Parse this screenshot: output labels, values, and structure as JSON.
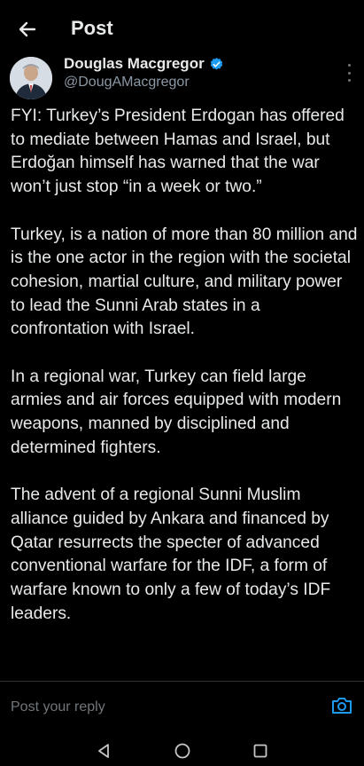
{
  "header": {
    "title": "Post"
  },
  "author": {
    "name": "Douglas Macgregor",
    "handle": "@DougAMacgregor"
  },
  "post": {
    "paragraphs": [
      "FYI: Turkey’s President Erdogan has offered to mediate between Hamas and Israel, but Erdoğan himself has warned that the war won’t just stop “in a week or two.”",
      "Turkey, is a nation of more than 80 million and is the one actor in the region with the societal cohesion, martial culture, and military power to lead the Sunni Arab states in a confrontation with Israel.",
      "In a regional war, Turkey can field large armies and air forces equipped with modern weapons, manned by disciplined and determined fighters.",
      "The advent of a regional Sunni Muslim alliance guided by Ankara and financed by Qatar resurrects the specter of advanced conventional warfare for the IDF, a form of warfare known to only a few of today’s IDF leaders."
    ]
  },
  "reply": {
    "placeholder": "Post your reply"
  },
  "icons": {
    "back": "arrow-left-icon",
    "verified": "verified-badge-icon",
    "more": "more-vertical-icon",
    "camera": "camera-icon",
    "nav_back": "triangle-back-icon",
    "nav_home": "circle-home-icon",
    "nav_recents": "square-recents-icon"
  },
  "colors": {
    "background": "#000000",
    "text": "#e7e9ea",
    "secondary": "#8b98a5",
    "accent": "#1d9bf0"
  }
}
